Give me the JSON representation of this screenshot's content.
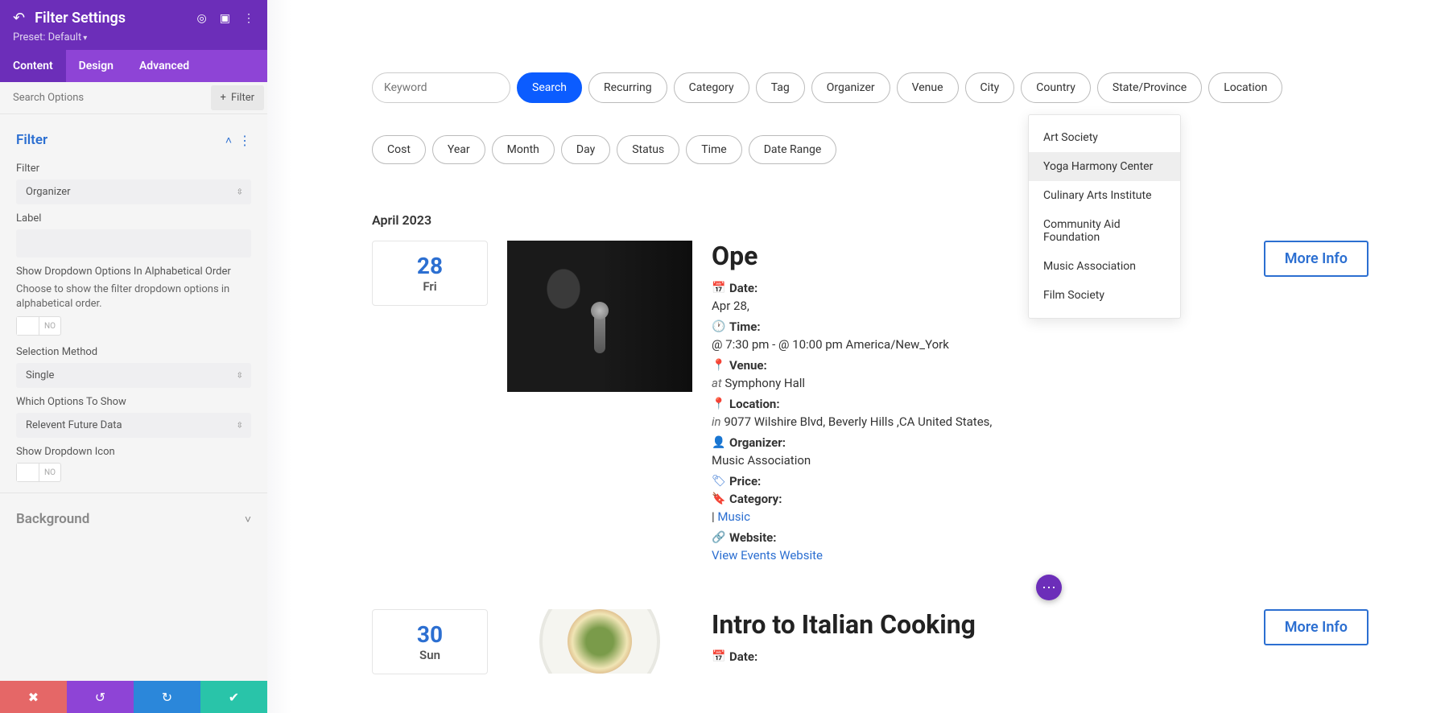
{
  "sidebar": {
    "title": "Filter Settings",
    "preset_label": "Preset: Default",
    "tabs": {
      "content": "Content",
      "design": "Design",
      "advanced": "Advanced"
    },
    "search_placeholder": "Search Options",
    "add_filter_label": "Filter",
    "filter_section_title": "Filter",
    "filter_label": "Filter",
    "filter_value": "Organizer",
    "label_label": "Label",
    "label_value": "",
    "alpha_label": "Show Dropdown Options In Alphabetical Order",
    "alpha_help": "Choose to show the filter dropdown options in alphabetical order.",
    "alpha_toggle": "NO",
    "selection_label": "Selection Method",
    "selection_value": "Single",
    "which_label": "Which Options To Show",
    "which_value": "Relevent Future Data",
    "dropdown_icon_label": "Show Dropdown Icon",
    "dropdown_icon_toggle": "NO",
    "background_section": "Background"
  },
  "main": {
    "keyword_placeholder": "Keyword",
    "pills_row1": [
      "Search",
      "Recurring",
      "Category",
      "Tag",
      "Organizer",
      "Venue",
      "City",
      "Country",
      "State/Province",
      "Location"
    ],
    "pills_row2": [
      "Cost",
      "Year",
      "Month",
      "Day",
      "Status",
      "Time",
      "Date Range"
    ],
    "dropdown": [
      "Art Society",
      "Yoga Harmony Center",
      "Culinary Arts Institute",
      "Community Aid Foundation",
      "Music Association",
      "Film Society"
    ],
    "month_heading": "April 2023",
    "events": [
      {
        "date_num": "28",
        "date_day": "Fri",
        "title": "Ope",
        "date_label": "Date:",
        "date_value": "Apr 28,",
        "time_label": "Time:",
        "time_value": "@ 7:30 pm - @ 10:00 pm America/New_York",
        "venue_label": "Venue:",
        "venue_prefix": "at",
        "venue_value": "Symphony Hall",
        "location_label": "Location:",
        "location_prefix": "in",
        "location_value": "9077 Wilshire Blvd, Beverly Hills ,CA United States,",
        "organizer_label": "Organizer:",
        "organizer_value": "Music Association",
        "price_label": "Price:",
        "category_label": "Category:",
        "category_link": "Music",
        "website_label": "Website:",
        "website_link": "View Events Website",
        "more_info": "More Info"
      },
      {
        "date_num": "30",
        "date_day": "Sun",
        "title": "Intro to Italian Cooking",
        "date_label": "Date:",
        "more_info": "More Info"
      }
    ]
  }
}
